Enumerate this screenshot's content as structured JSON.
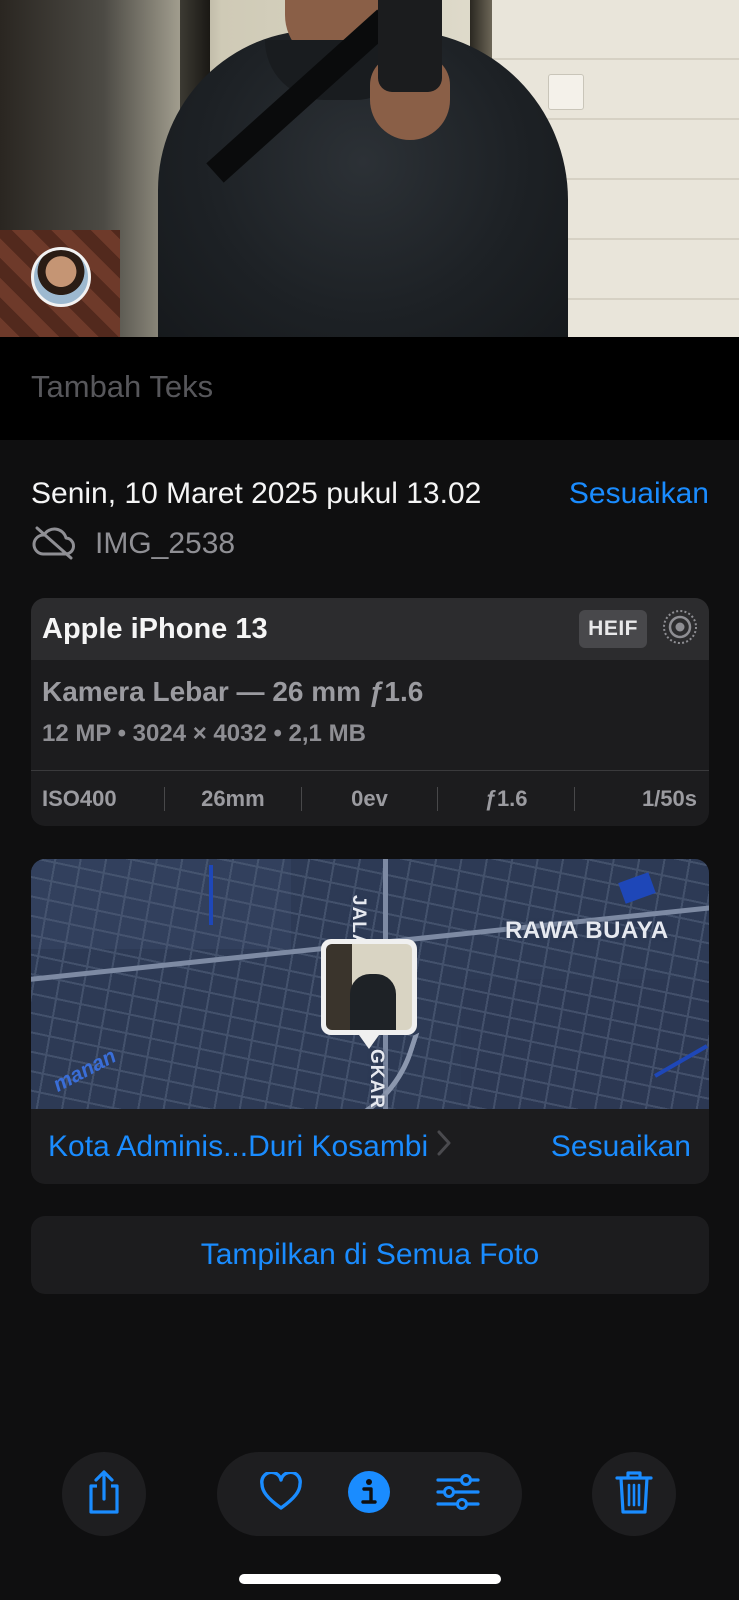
{
  "caption": {
    "placeholder": "Tambah Teks"
  },
  "info": {
    "date": "Senin, 10 Maret 2025 pukul 13.02",
    "adjust_label": "Sesuaikan",
    "filename": "IMG_2538",
    "cloud_icon": "cloud-off-icon"
  },
  "camera": {
    "device": "Apple iPhone 13",
    "format_badge": "HEIF",
    "lens": "Kamera Lebar — 26 mm ƒ1.6",
    "specs": "12 MP • 3024 × 4032 • 2,1 MB",
    "exif": [
      "ISO400",
      "26mm",
      "0ev",
      "ƒ1.6",
      "1/50s"
    ]
  },
  "map": {
    "labels": {
      "rawa_buaya": "RAWA BUAYA",
      "jalan": "JALAN",
      "gkar": "GKAR",
      "manan": "manan"
    },
    "location": "Kota Adminis...Duri Kosambi",
    "adjust_label": "Sesuaikan"
  },
  "actions": {
    "show_all_photos": "Tampilkan di Semua Foto"
  },
  "toolbar": {
    "items": [
      "share-icon",
      "heart-icon",
      "info-icon",
      "adjust-icon",
      "trash-icon"
    ]
  },
  "colors": {
    "accent": "#1a8cff",
    "background": "#0f0f10",
    "card": "#1c1c1e",
    "card_header": "#2c2c2e"
  }
}
